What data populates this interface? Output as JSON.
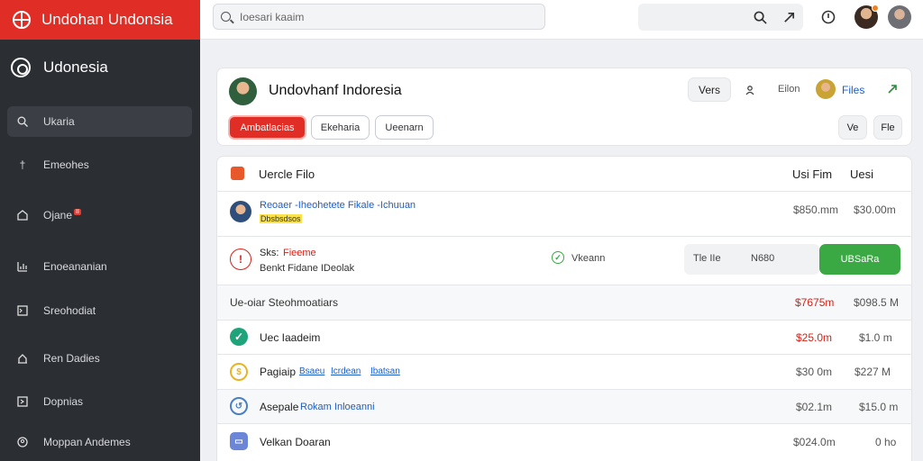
{
  "app": {
    "title": "Undohan Undonsia"
  },
  "search": {
    "placeholder": "Ioesari kaaim"
  },
  "sidebar": {
    "heading": "Udonesia",
    "items": [
      {
        "label": "Ukaria",
        "icon": "search-icon",
        "active": true
      },
      {
        "label": "Emeohes",
        "icon": "pin-icon"
      },
      {
        "label": "Ojane",
        "icon": "shop-icon",
        "badge": "II"
      },
      {
        "label": "Enoeananian",
        "icon": "chart-icon"
      },
      {
        "label": "Sreohodiat",
        "icon": "terminal-icon"
      },
      {
        "label": "Ren Dadies",
        "icon": "home-icon"
      },
      {
        "label": "Dopnias",
        "icon": "caret-icon"
      },
      {
        "label": "Moppan Andemes",
        "icon": "person-icon"
      }
    ]
  },
  "header": {
    "title": "Undovhanf Indoresia",
    "vers_label": "Vers",
    "files_prefix": "Eilon",
    "files_label": "Files",
    "tabs": [
      "Ambatlacias",
      "Ekeharia",
      "Ueenarn"
    ],
    "small_btn_1": "Ve",
    "small_btn_2": "Fle"
  },
  "table": {
    "title": "Uercle Filo",
    "col1": "Usi Fim",
    "col2": "Uesi",
    "rows": {
      "r1": {
        "text": "Reoaer -Iheohetete Fikale -Ichuuan",
        "hl": "Dbsbsdsos",
        "v1": "$850.mm",
        "v2": "$30.00m"
      },
      "r2": {
        "line1_a": "Sks:",
        "line1_b": "Fieeme",
        "line2": "Benkt Fidane IDeolak",
        "status": "Vkeann",
        "field_a": "Tle IIe",
        "field_b": "N680",
        "action": "UBSaRa"
      },
      "r3": {
        "text": "Ue-oiar Steohmoatiars",
        "v1": "$7675m",
        "v2": "$098.5 M"
      },
      "r4": {
        "text": "Uec Iaadeim",
        "v1": "$25.0m",
        "v2": "$1.0 m"
      },
      "r5": {
        "text": "Pagiaip",
        "l1": "Bsaeu",
        "l2": "Icrdean",
        "l3": "Ibatsan",
        "v1": "$30 0m",
        "v2": "$227 M"
      },
      "r6": {
        "text": "Asepale",
        "link": "Rokam Inloeanni",
        "v1": "$02.1m",
        "v2": "$15.0 m"
      },
      "r7": {
        "text": "Velkan Doaran",
        "v1": "$024.0m",
        "v2": "0 ho"
      }
    }
  },
  "colors": {
    "accent": "#e02d25",
    "sidebar": "#2b2e33",
    "success": "#3aa843",
    "link": "#1a5ec8"
  }
}
